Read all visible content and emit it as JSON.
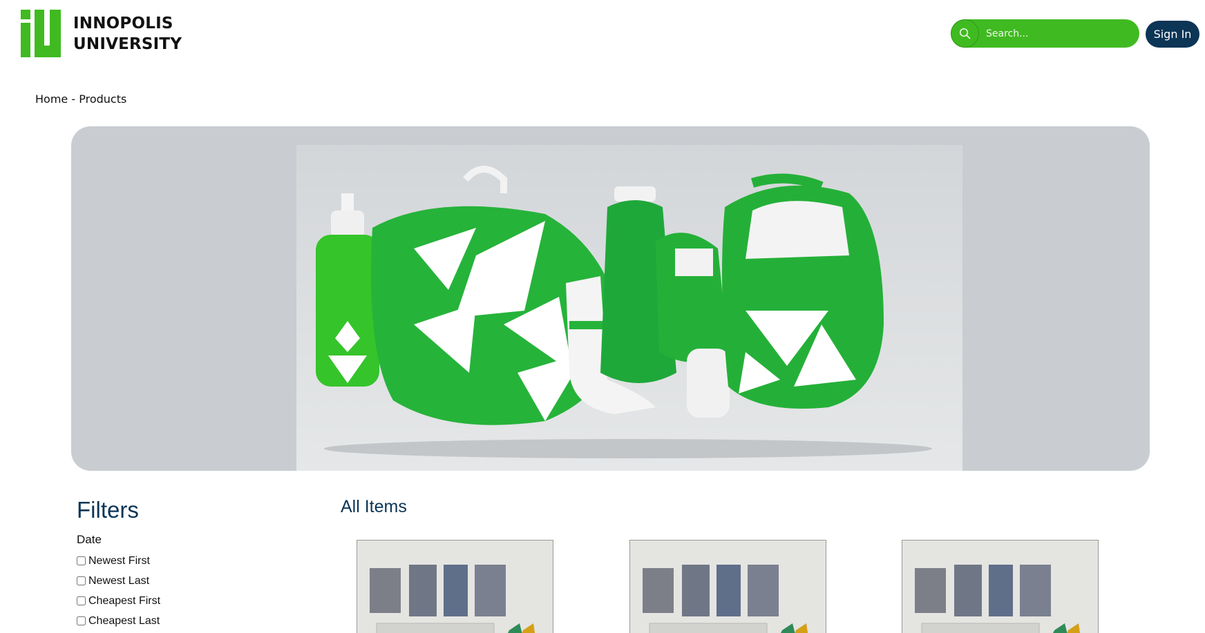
{
  "brand": {
    "line1": "INNOPOLIS",
    "line2": "UNIVERSITY"
  },
  "header": {
    "search_placeholder": "Search...",
    "signin_label": "Sign In"
  },
  "breadcrumb": {
    "home": "Home",
    "separator": "-",
    "current": "Products"
  },
  "filters": {
    "title": "Filters",
    "group": "Date",
    "options": [
      "Newest First",
      "Newest Last",
      "Cheapest First",
      "Cheapest Last"
    ]
  },
  "main": {
    "title": "All Items"
  },
  "colors": {
    "brand_green": "#40ba21",
    "navy": "#0c3556",
    "hero_bg": "#c9cdd1"
  },
  "icons": [
    "search-icon"
  ]
}
